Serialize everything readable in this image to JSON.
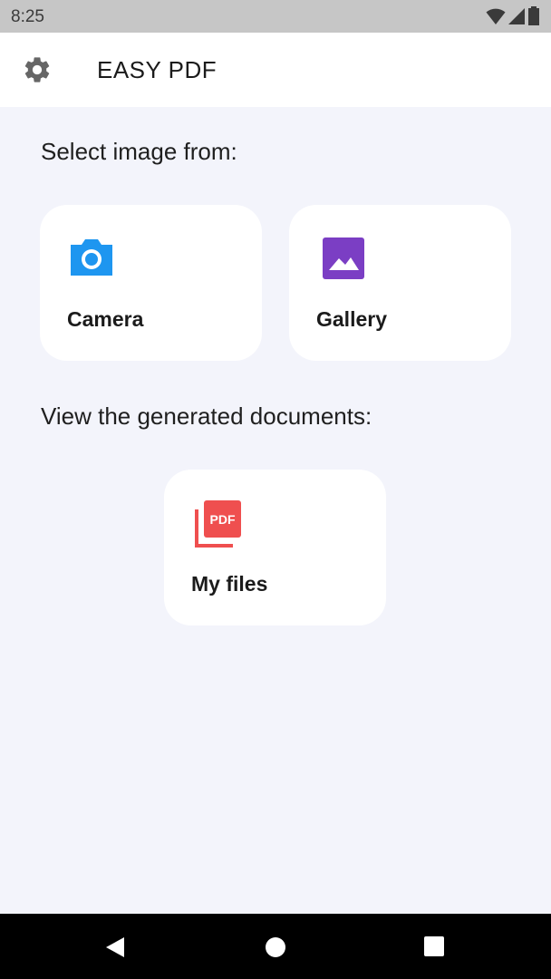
{
  "status_bar": {
    "time": "8:25"
  },
  "app_bar": {
    "title": "EASY PDF"
  },
  "sections": {
    "select_image_label": "Select image from:",
    "view_documents_label": "View the generated documents:"
  },
  "cards": {
    "camera": {
      "label": "Camera",
      "icon": "camera-icon",
      "color": "#1e96f0"
    },
    "gallery": {
      "label": "Gallery",
      "icon": "image-icon",
      "color": "#7b3ec4"
    },
    "my_files": {
      "label": "My files",
      "icon": "pdf-files-icon",
      "color": "#ef4f4f",
      "badge_text": "PDF"
    }
  },
  "colors": {
    "background": "#f3f4fb",
    "status_bar": "#c6c6c6",
    "nav_bar": "#000000"
  }
}
